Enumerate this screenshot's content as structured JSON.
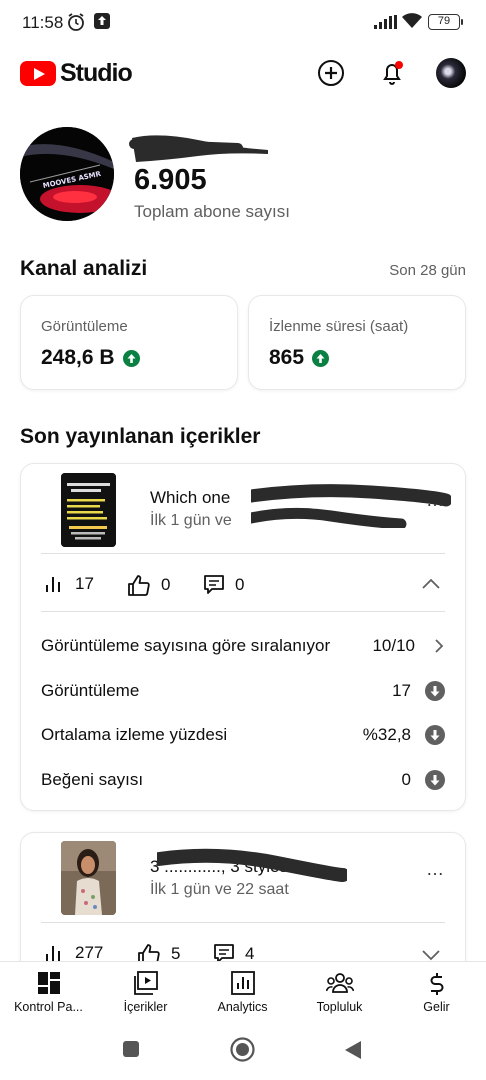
{
  "status_bar": {
    "time": "11:58",
    "battery": "79"
  },
  "header": {
    "app_name": "Studio",
    "brand_color": "#ff0000",
    "icons": [
      "create-icon",
      "notifications-icon",
      "account-avatar"
    ]
  },
  "channel": {
    "avatar_text": "MOOVES ASMR",
    "subscriber_count": "6.905",
    "subscriber_label": "Toplam abone sayısı"
  },
  "analytics": {
    "title": "Kanal analizi",
    "period": "Son 28 gün",
    "metrics": [
      {
        "label": "Görüntüleme",
        "value": "248,6 B",
        "trend": "up"
      },
      {
        "label": "İzlenme süresi (saat)",
        "value": "865",
        "trend": "up"
      }
    ]
  },
  "recent": {
    "title": "Son yayınlanan içerikler",
    "videos": [
      {
        "title": "Which one",
        "subtitle": "İlk 1 gün ve",
        "stats": {
          "views": "17",
          "likes": "0",
          "comments": "0"
        },
        "expanded": true,
        "rank_label": "Görüntüleme sayısına göre sıralanıyor",
        "rank_value": "10/10",
        "rows": [
          {
            "label": "Görüntüleme",
            "value": "17"
          },
          {
            "label": "Ortalama izleme yüzdesi",
            "value": "%32,8"
          },
          {
            "label": "Beğeni sayısı",
            "value": "0"
          }
        ]
      },
      {
        "title": "3 ............, 3 styles",
        "subtitle": "İlk 1 gün ve 22 saat",
        "stats": {
          "views": "277",
          "likes": "5",
          "comments": "4"
        },
        "expanded": false
      }
    ]
  },
  "bottom_nav": [
    {
      "label": "Kontrol Pa...",
      "icon": "dashboard-icon"
    },
    {
      "label": "İçerikler",
      "icon": "content-icon"
    },
    {
      "label": "Analytics",
      "icon": "analytics-icon"
    },
    {
      "label": "Topluluk",
      "icon": "community-icon"
    },
    {
      "label": "Gelir",
      "icon": "earn-icon"
    }
  ],
  "colors": {
    "trend_up": "#0b8043",
    "secondary_text": "#606060"
  }
}
